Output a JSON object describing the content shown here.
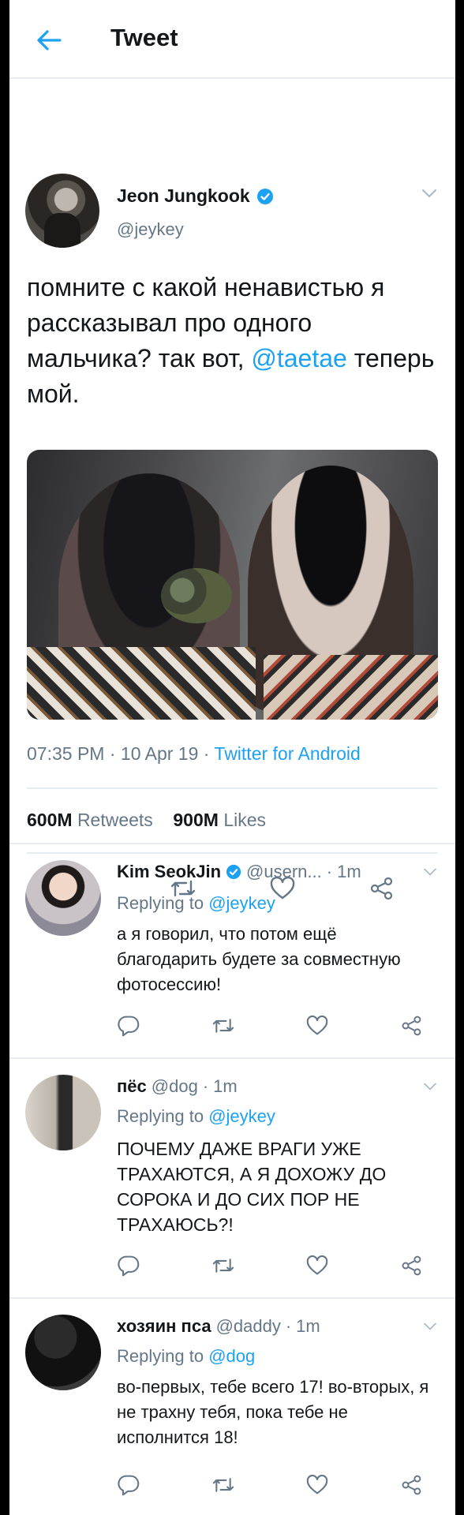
{
  "header": {
    "title": "Tweet"
  },
  "tweet": {
    "author_name": "Jeon Jungkook",
    "author_handle": "@jeykey",
    "text_before": "помните с какой ненавистью я рассказывал про одного мальчика? так вот, ",
    "mention": "@taetae",
    "text_after": " теперь мой.",
    "time": "07:35 PM",
    "date": "10 Apr 19",
    "source": "Twitter for Android",
    "dot": "·",
    "retweets_count": "600M",
    "retweets_label": "Retweets",
    "likes_count": "900M",
    "likes_label": "Likes"
  },
  "replies": [
    {
      "name": "Kim SeokJin",
      "verified": true,
      "handle": "@usern...",
      "time": "1m",
      "replying_label": "Replying to",
      "replying_to": "@jeykey",
      "text": "а я говорил, что потом ещё благодарить будете за совместную фотосессию!"
    },
    {
      "name": "пёс",
      "verified": false,
      "handle": "@dog",
      "time": "1m",
      "replying_label": "Replying to",
      "replying_to": "@jeykey",
      "text": "ПОЧЕМУ ДАЖЕ ВРАГИ УЖЕ ТРАХАЮТСЯ, А Я  ДОХОЖУ ДО СОРОКА И ДО СИХ ПОР НЕ ТРАХАЮСЬ?!"
    },
    {
      "name": "хозяин пса",
      "verified": false,
      "handle": "@daddy",
      "time": "1m",
      "replying_label": "Replying to",
      "replying_to": "@dog",
      "text": "во-первых, тебе всего 17! во-вторых, я не трахну тебя, пока тебе не исполнится 18!"
    }
  ],
  "colors": {
    "accent": "#1da1f2",
    "secondary_text": "#657786",
    "divider": "#e6ecf0"
  },
  "icons": [
    "back-arrow-icon",
    "verified-badge-icon",
    "chevron-down-icon",
    "reply-icon",
    "retweet-icon",
    "like-icon",
    "share-icon"
  ]
}
